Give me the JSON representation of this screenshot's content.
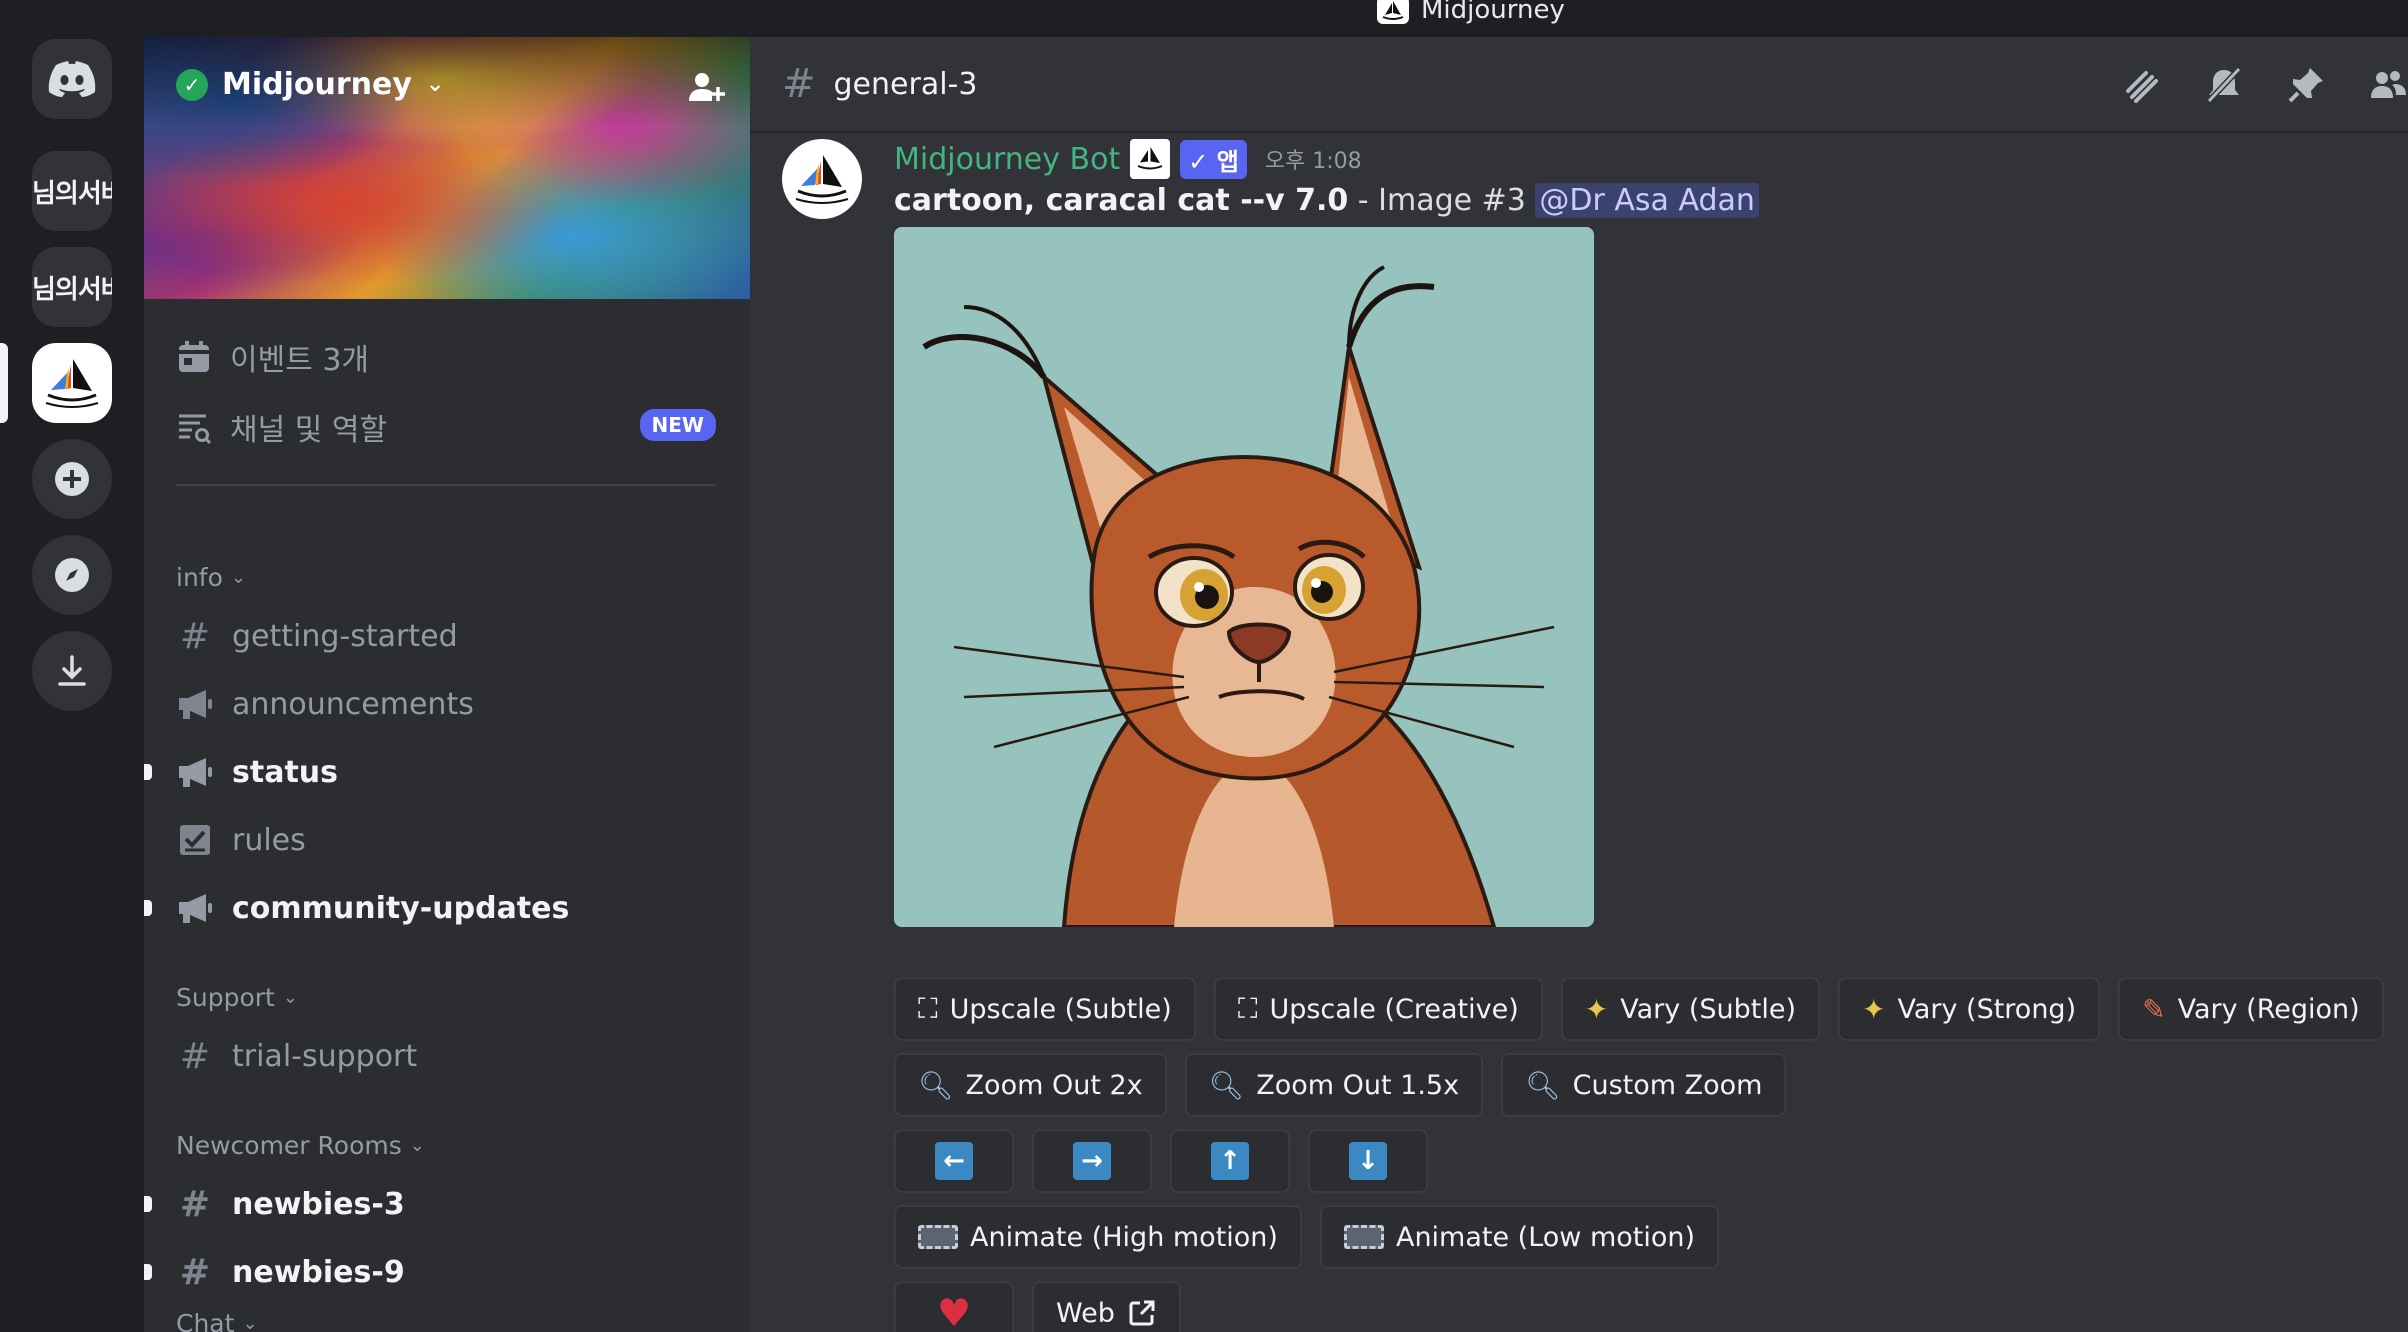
{
  "window": {
    "title": "Midjourney"
  },
  "servers": [
    {
      "label": "님의서버"
    },
    {
      "label": "님의서버"
    }
  ],
  "sidebar": {
    "server_name": "Midjourney",
    "events_label": "이벤트 3개",
    "roles_label": "채널 및 역할",
    "new_badge": "NEW",
    "categories": {
      "info": "info",
      "support": "Support",
      "newcomer": "Newcomer Rooms",
      "chat": "Chat"
    },
    "channels": {
      "getting_started": "getting-started",
      "announcements": "announcements",
      "status": "status",
      "rules": "rules",
      "community_updates": "community-updates",
      "trial_support": "trial-support",
      "newbies_3": "newbies-3",
      "newbies_9": "newbies-9"
    }
  },
  "header": {
    "channel": "general-3"
  },
  "message": {
    "author": "Midjourney Bot",
    "app_badge": "✓ 앱",
    "time": "오후 1:08",
    "prompt": "cartoon, caracal cat --v 7.0",
    "suffix": " - Image #3 ",
    "mention": "@Dr Asa Adan"
  },
  "buttons": {
    "upscale_subtle": "Upscale (Subtle)",
    "upscale_creative": "Upscale (Creative)",
    "vary_subtle": "Vary (Subtle)",
    "vary_strong": "Vary (Strong)",
    "vary_region": "Vary (Region)",
    "zoom_out_2x": "Zoom Out 2x",
    "zoom_out_1_5x": "Zoom Out 1.5x",
    "custom_zoom": "Custom Zoom",
    "animate_high": "Animate (High motion)",
    "animate_low": "Animate (Low motion)",
    "web": "Web"
  },
  "colors": {
    "author_green": "#43b581",
    "brand_blurple": "#5865f2",
    "heart_red": "#dd2e44"
  }
}
